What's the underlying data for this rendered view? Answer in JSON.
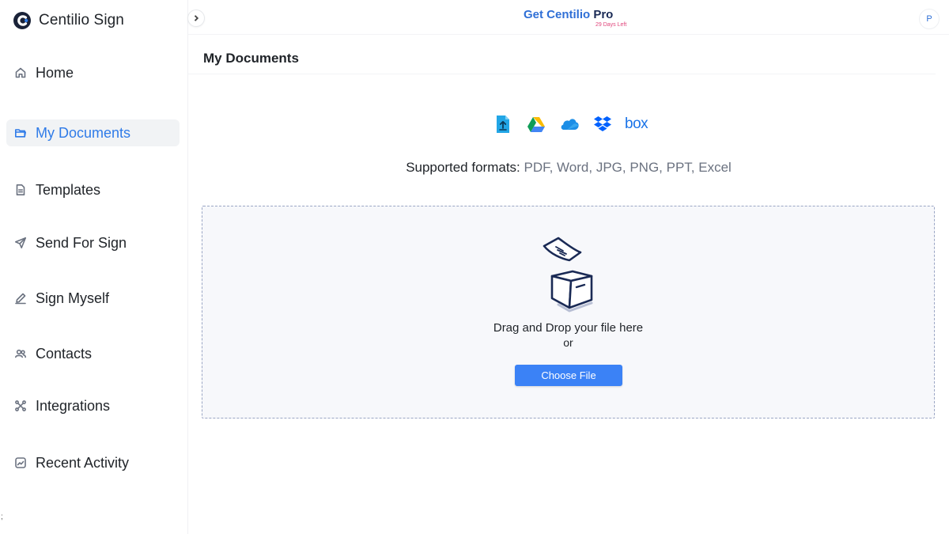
{
  "app": {
    "name": "Centilio Sign"
  },
  "header": {
    "promo_title": "Get Centilio",
    "promo_title_accent": "Pro",
    "promo_sub": "29 Days Left",
    "avatar_initial": "P"
  },
  "sidebar": {
    "items": [
      {
        "label": "Home",
        "icon": "home-icon"
      },
      {
        "label": "My Documents",
        "icon": "folder-icon",
        "active": true
      },
      {
        "label": "Templates",
        "icon": "document-icon"
      },
      {
        "label": "Send For Sign",
        "icon": "send-icon"
      },
      {
        "label": "Sign Myself",
        "icon": "pen-icon"
      },
      {
        "label": "Contacts",
        "icon": "users-icon"
      },
      {
        "label": "Integrations",
        "icon": "integrations-icon"
      },
      {
        "label": "Recent Activity",
        "icon": "activity-icon"
      }
    ],
    "stray_text": ";"
  },
  "main": {
    "page_title": "My Documents",
    "sources": [
      {
        "name": "upload-from-device-icon"
      },
      {
        "name": "google-drive-icon"
      },
      {
        "name": "onedrive-icon"
      },
      {
        "name": "dropbox-icon"
      },
      {
        "name": "box-icon",
        "label": "box"
      }
    ],
    "formats_label": "Supported formats:",
    "formats_list": "PDF, Word, JPG, PNG, PPT, Excel",
    "dropzone": {
      "text": "Drag and Drop your file here",
      "or": "or",
      "button": "Choose File"
    }
  },
  "colors": {
    "accent": "#2f7be8",
    "button": "#3b82f6",
    "promo_sub": "#e0457b",
    "dropzone_bg": "#f7f8fb"
  }
}
